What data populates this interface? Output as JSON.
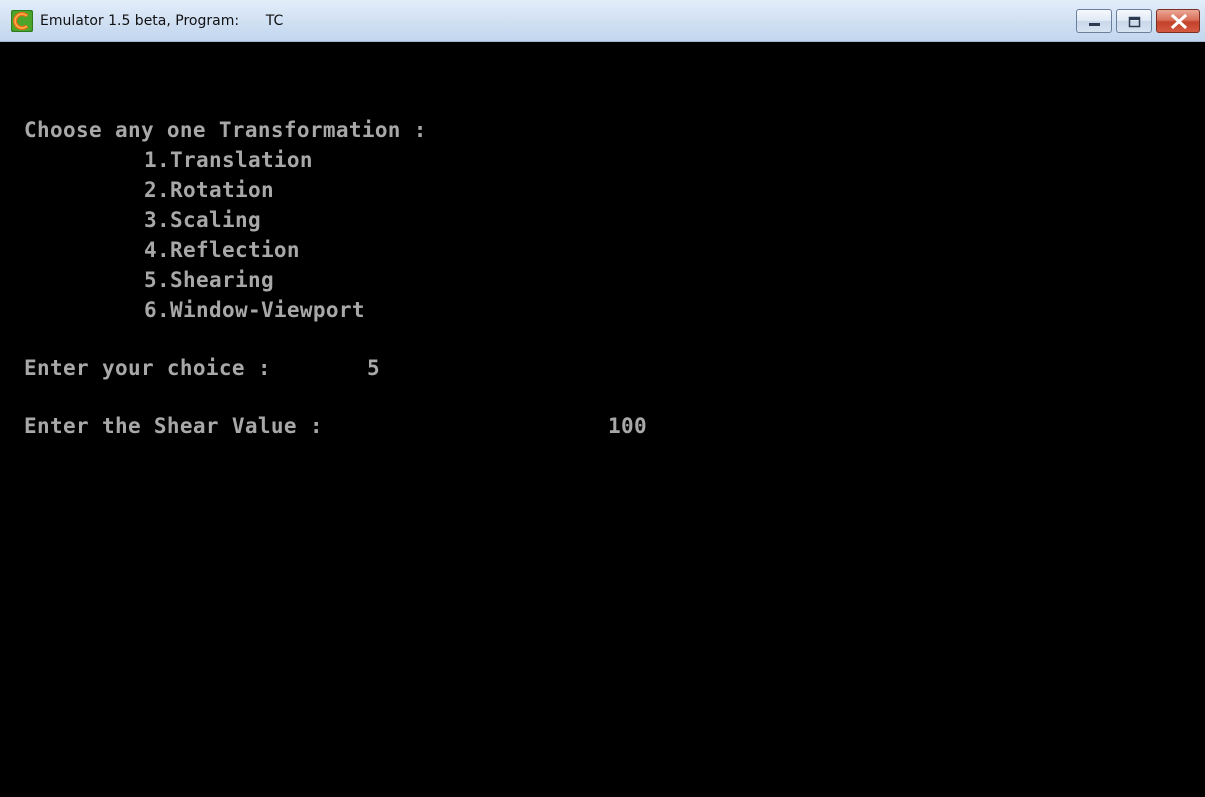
{
  "window": {
    "title": "Emulator 1.5 beta, Program:",
    "program": "TC",
    "icon": "emulator-app-icon",
    "controls": [
      "minimize-icon",
      "maximize-icon",
      "close-icon"
    ],
    "colors": {
      "console_bg": "#000000",
      "console_text": "#a8a8a8",
      "close_button": "#c7432c"
    }
  },
  "console": {
    "prompt_heading": "Choose any one Transformation :",
    "options": [
      "1.Translation",
      "2.Rotation",
      "3.Scaling",
      "4.Reflection",
      "5.Shearing",
      "6.Window-Viewport"
    ],
    "choice_prompt": "Enter your choice :",
    "choice_value": "5",
    "shear_prompt": "Enter the Shear Value :",
    "shear_value": "100"
  }
}
